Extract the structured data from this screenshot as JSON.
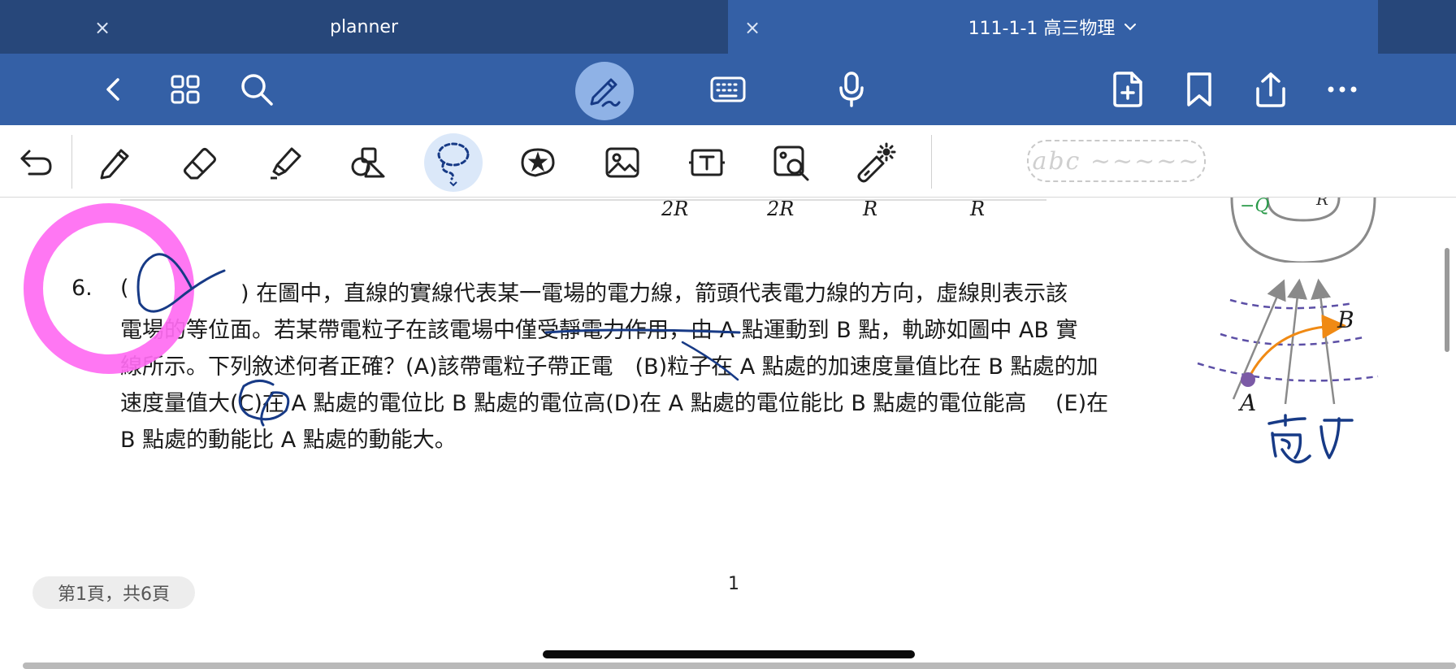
{
  "tabs": [
    {
      "label": "planner",
      "close": "×"
    },
    {
      "label": "111-1-1 高三物理",
      "close": "×",
      "chevron": "⌄"
    }
  ],
  "toolbar": {
    "left_icons": [
      "back-icon",
      "grid-icon",
      "search-icon"
    ],
    "center_icons": [
      "pen-mode-icon",
      "keyboard-icon",
      "microphone-icon"
    ],
    "right_icons": [
      "add-page-icon",
      "bookmark-icon",
      "share-icon",
      "more-icon"
    ],
    "accent": "#3460a6"
  },
  "tools": {
    "items": [
      "undo",
      "pen",
      "eraser",
      "highlighter",
      "shapes",
      "lasso",
      "sticker",
      "image",
      "text",
      "zoom-window",
      "laser-pointer"
    ],
    "selected": "lasso",
    "handwriting_placeholder": "abc ~~~~~"
  },
  "question": {
    "number": "6.",
    "open_paren": "(",
    "lines": [
      ") 在圖中，直線的實線代表某一電場的電力線，箭頭代表電力線的方向，虛線則表示該",
      "電場的等位面。若某帶電粒子在該電場中僅受靜電力作用，由 A 點運動到 B 點，軌跡如圖中 AB 實",
      "線所示。下列敘述何者正確？(A)該帶電粒子帶正電　(B)粒子在 A 點處的加速度量值比在 B 點處的加",
      "速度量值大(C)在 A 點處的電位比 B 點處的電位高(D)在 A 點處的電位能比 B 點處的電位能高　 (E)在",
      "B 點處的動能比 A 點處的動能大。"
    ]
  },
  "prev_question": {
    "denominators": [
      "2R",
      "2R",
      "R",
      "R"
    ],
    "label_q": "−Q",
    "label_r": "R"
  },
  "figure": {
    "label_a": "A",
    "label_b": "B",
    "handwriting": "高V"
  },
  "footer": {
    "page_info": "第1頁，共6頁",
    "page_number": "1"
  },
  "colors": {
    "tab_dark": "#27477a",
    "tab_active": "#3460a6",
    "ink_blue": "#173a86",
    "highlight_pink": "#ff6bf2",
    "field_line": "#8a8a8a",
    "equipotential": "#5c4fa6",
    "trajectory": "#f08a14"
  }
}
